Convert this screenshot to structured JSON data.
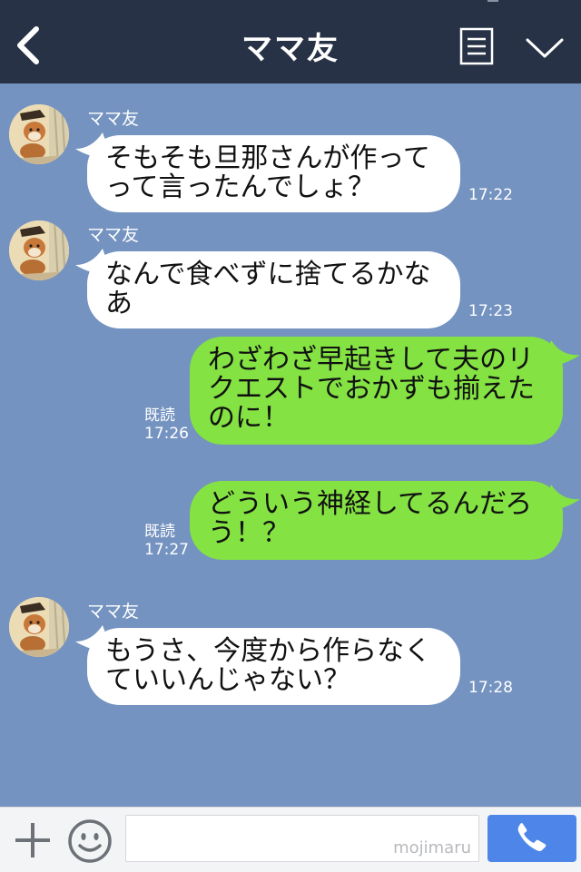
{
  "header": {
    "title": "ママ友"
  },
  "messages": [
    {
      "sender": "ママ友",
      "text": "そもそも旦那さんが作って\nって言ったんでしょ？",
      "time": "17:22"
    },
    {
      "sender": "ママ友",
      "text": "なんで食べずに捨てるかな\nあ",
      "time": "17:23"
    },
    {
      "read": "既読",
      "text": "わざわざ早起きして夫のリ\nクエストでおかずも揃えた\nのに！",
      "time": "17:26"
    },
    {
      "read": "既読",
      "text": "どういう神経してるんだろ\nう！？",
      "time": "17:27"
    },
    {
      "sender": "ママ友",
      "text": "もうさ、今度から作らなく\nていいんじゃない？",
      "time": "17:28"
    }
  ],
  "footer": {
    "watermark": "mojimaru"
  },
  "icons": {
    "back": "chevron-left-icon",
    "menu": "notes-icon",
    "collapse": "chevron-down-icon",
    "add": "plus-icon",
    "emoji": "smiley-icon",
    "call": "phone-icon"
  },
  "colors": {
    "header_bg": "#273246",
    "chat_bg": "#7493c0",
    "incoming_bubble": "#ffffff",
    "outgoing_bubble": "#84e243",
    "call_button": "#4d86e8"
  }
}
